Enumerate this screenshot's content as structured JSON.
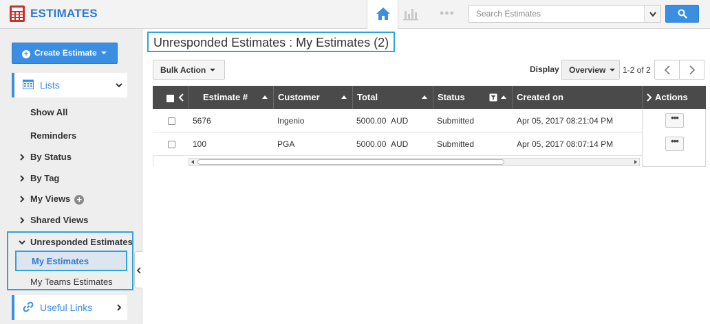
{
  "app": {
    "title": "ESTIMATES",
    "logo_icon": "calculator-icon",
    "brand_color": "#2a7bd2",
    "accent_color": "#3a8fe2",
    "highlight_color": "#2aa6db"
  },
  "topnav": {
    "home_icon": "home-icon",
    "chart_icon": "bar-chart-icon",
    "more_icon": "more-dots-icon",
    "search_placeholder": "Search Estimates",
    "search_icon": "search-icon"
  },
  "sidebar": {
    "create_label": "Create Estimate",
    "lists_label": "Lists",
    "items": [
      {
        "label": "Show All"
      },
      {
        "label": "Reminders"
      },
      {
        "label": "By Status"
      },
      {
        "label": "By Tag"
      },
      {
        "label": "My Views"
      },
      {
        "label": "Shared Views"
      }
    ],
    "unresponded_label": "Unresponded Estimates",
    "my_estimates_label": "My Estimates",
    "teams_estimates_label": "My Teams Estimates",
    "useful_links_label": "Useful Links"
  },
  "main": {
    "page_title": "Unresponded Estimates : My Estimates (2)",
    "bulk_action_label": "Bulk Action",
    "display_label": "Display",
    "view_label": "Overview",
    "page_count": "1-2 of 2"
  },
  "table": {
    "columns": [
      {
        "label": "Estimate #"
      },
      {
        "label": "Customer"
      },
      {
        "label": "Total"
      },
      {
        "label": "Status"
      },
      {
        "label": "Created on"
      },
      {
        "label": "Actions"
      }
    ],
    "rows": [
      {
        "estimate": "5676",
        "customer": "Ingenio",
        "amount": "5000.00",
        "currency": "AUD",
        "status": "Submitted",
        "created": "Apr 05, 2017 08:21:04 PM",
        "actions": "•••"
      },
      {
        "estimate": "100",
        "customer": "PGA",
        "amount": "5000.00",
        "currency": "AUD",
        "status": "Submitted",
        "created": "Apr 05, 2017 08:07:14 PM",
        "actions": "•••"
      }
    ]
  }
}
